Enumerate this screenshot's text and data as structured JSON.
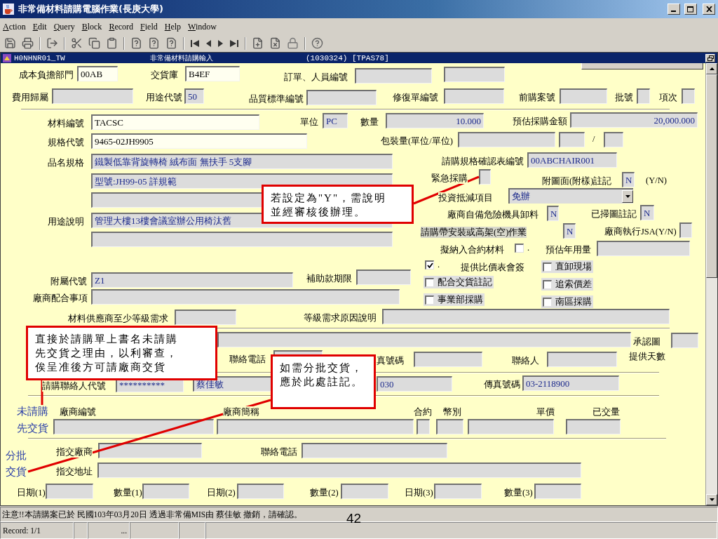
{
  "window": {
    "title": "非常備材料請購電腦作業(長庚大學)"
  },
  "menu": [
    "Action",
    "Edit",
    "Query",
    "Block",
    "Record",
    "Field",
    "Help",
    "Window"
  ],
  "form": {
    "name": "H0NHNR01_TW",
    "heading": "非常備材料請購輸入",
    "info": "(1030324) [TPAS78]"
  },
  "items": [
    {
      "kind": "field",
      "label": "成本負擔部門",
      "value": "00AB",
      "editable": true
    },
    {
      "kind": "field",
      "label": "交貨庫",
      "value": "B4EF",
      "editable": true
    },
    {
      "kind": "field",
      "label": "訂單、人員編號",
      "editable": false
    },
    {
      "kind": "field",
      "editable": false
    },
    {
      "kind": "field",
      "label": "費用歸屬",
      "editable": false
    },
    {
      "kind": "field",
      "label": "用途代號",
      "value": "50",
      "editable": false
    },
    {
      "kind": "field",
      "label": "品質標準編號",
      "editable": false
    },
    {
      "kind": "field",
      "label": "修復單編號",
      "editable": false
    },
    {
      "kind": "field",
      "label": "前購案號",
      "editable": false
    },
    {
      "kind": "field",
      "label": "批號",
      "editable": false
    },
    {
      "kind": "field",
      "label": "項次",
      "editable": false
    },
    {
      "kind": "field",
      "label": "材料編號",
      "value": "TACSC",
      "editable": true
    },
    {
      "kind": "field",
      "label": "單位",
      "value": "PC",
      "editable": false
    },
    {
      "kind": "field",
      "label": "數量",
      "value": "10.000",
      "editable": false
    },
    {
      "kind": "field",
      "label": "預估採購金額",
      "value": "20,000.000",
      "editable": false
    },
    {
      "kind": "field",
      "label": "規格代號",
      "value": "9465-02JH9905",
      "editable": true
    },
    {
      "kind": "field",
      "label": "包裝量(單位/單位)",
      "editable": false
    },
    {
      "kind": "field",
      "editable": false
    },
    {
      "kind": "text",
      "text": "/"
    },
    {
      "kind": "field",
      "editable": false
    },
    {
      "kind": "field",
      "label": "品名規格",
      "value": "鐵製低靠背旋轉椅 絨布面 無扶手 5支腳",
      "editable": false
    },
    {
      "kind": "field",
      "label": "請購規格確認表編號",
      "value": "00ABCHAIR001",
      "editable": false
    },
    {
      "kind": "field",
      "value": "型號:JH99-05 詳規範",
      "editable": false
    },
    {
      "kind": "field",
      "label": "緊急採購",
      "editable": false
    },
    {
      "kind": "field",
      "label": "附圖面(附樣)註記",
      "value": "N",
      "editable": false
    },
    {
      "kind": "text",
      "text": "(Y/N)"
    },
    {
      "kind": "field",
      "editable": false
    },
    {
      "kind": "dropdown",
      "label": "投資抵減項目",
      "value": "免辦"
    },
    {
      "kind": "field",
      "label": "用途說明",
      "value": "管理大樓13樓會議室辦公用椅汰舊",
      "editable": false
    },
    {
      "kind": "field",
      "label": "廠商自備危險機具卸料",
      "value": "N",
      "editable": false
    },
    {
      "kind": "field",
      "label": "已掃圖註記",
      "value": "N",
      "editable": false
    },
    {
      "kind": "field",
      "editable": false
    },
    {
      "kind": "field",
      "label": "請購帶安裝或高架(空)作業",
      "value": "N",
      "editable": false
    },
    {
      "kind": "field",
      "label": "廠商執行JSA(Y/N)",
      "editable": false
    },
    {
      "kind": "checkbox",
      "label": "擬納入合約材料",
      "caption": ".",
      "checked": false
    },
    {
      "kind": "field",
      "label": "預估年用量",
      "editable": false
    },
    {
      "kind": "checkbox",
      "label": "提供比價表會簽",
      "caption": ".",
      "checked": true
    },
    {
      "kind": "checkbox",
      "label": "直卸現場",
      "checked": false
    },
    {
      "kind": "field",
      "label": "附屬代號",
      "value": "Z1",
      "editable": false
    },
    {
      "kind": "field",
      "label": "補助款期限",
      "editable": false
    },
    {
      "kind": "checkbox",
      "label": "配合交貨註記",
      "checked": false
    },
    {
      "kind": "checkbox",
      "label": "追索價差",
      "checked": false
    },
    {
      "kind": "field",
      "label": "廠商配合事項",
      "editable": false
    },
    {
      "kind": "checkbox",
      "label": "事業部採購",
      "checked": false
    },
    {
      "kind": "checkbox",
      "label": "南區採購",
      "checked": false
    },
    {
      "kind": "field",
      "label": "材料供應商至少等級需求",
      "editable": false
    },
    {
      "kind": "field",
      "label": "等級需求原因說明",
      "editable": false
    },
    {
      "kind": "field",
      "editable": false
    },
    {
      "kind": "field",
      "label": "承認圖",
      "editable": false
    },
    {
      "kind": "field",
      "label": "聯絡電話",
      "editable": false
    },
    {
      "kind": "field",
      "label": "真號碼",
      "editable": false
    },
    {
      "kind": "field",
      "label": "聯絡人",
      "editable": false
    },
    {
      "kind": "text",
      "text": "提供天數"
    },
    {
      "kind": "field",
      "label": "請購聯絡人代號",
      "value": "**********",
      "editable": false
    },
    {
      "kind": "field",
      "value": "蔡佳敏",
      "editable": false
    },
    {
      "kind": "field",
      "value": "030",
      "editable": false
    },
    {
      "kind": "field",
      "label": "傳真號碼",
      "value": "03-2118900",
      "editable": false
    },
    {
      "kind": "note",
      "text": "未請購"
    },
    {
      "kind": "note",
      "text": "先交貨"
    },
    {
      "kind": "text",
      "text": "廠商編號"
    },
    {
      "kind": "text",
      "text": "廠商簡稱"
    },
    {
      "kind": "text",
      "text": "合約"
    },
    {
      "kind": "text",
      "text": "幣別"
    },
    {
      "kind": "text",
      "text": "單價"
    },
    {
      "kind": "text",
      "text": "已交量"
    },
    {
      "kind": "field",
      "editable": false
    },
    {
      "kind": "field",
      "editable": false
    },
    {
      "kind": "field",
      "editable": false
    },
    {
      "kind": "field",
      "editable": false
    },
    {
      "kind": "field",
      "editable": false
    },
    {
      "kind": "field",
      "editable": false
    },
    {
      "kind": "note",
      "text": "分批"
    },
    {
      "kind": "note",
      "text": "交貨"
    },
    {
      "kind": "field",
      "label": "指交廠商",
      "editable": false
    },
    {
      "kind": "field",
      "label": "聯絡電話",
      "editable": false
    },
    {
      "kind": "field",
      "label": "指交地址",
      "editable": false
    },
    {
      "kind": "field",
      "label": "日期(1)",
      "editable": false
    },
    {
      "kind": "field",
      "label": "數量(1)",
      "editable": false
    },
    {
      "kind": "field",
      "label": "日期(2)",
      "editable": false
    },
    {
      "kind": "field",
      "label": "數量(2)",
      "editable": false
    },
    {
      "kind": "field",
      "label": "日期(3)",
      "editable": false
    },
    {
      "kind": "field",
      "label": "數量(3)",
      "editable": false
    }
  ],
  "callouts": [
    {
      "lines": [
        "若設定為\"Y\"，需說明",
        "並經審核後辦理。"
      ]
    },
    {
      "lines": [
        "直接於請購單上書名未請購",
        "先交貨之理由，以利審查，",
        "俟呈准後方可請廠商交貨"
      ]
    },
    {
      "lines": [
        "如需分批交貨，",
        "應於此處註記。"
      ]
    }
  ],
  "status": {
    "message": "注意!!本請購案已於 民國103年03月20日 透過非常備MIS由 蔡佳敏 撤銷，請確認。",
    "record": "Record: 1/1",
    "more": "..."
  },
  "page_number": "42"
}
